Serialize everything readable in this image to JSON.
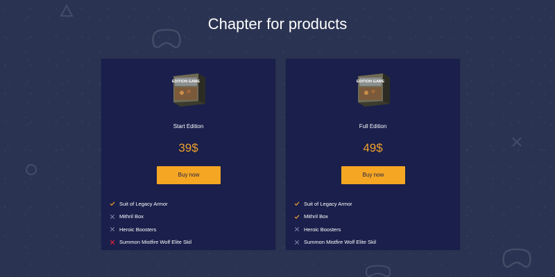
{
  "page": {
    "title": "Chapter for products"
  },
  "colors": {
    "background": "#2a3352",
    "card": "#1a1f4b",
    "accent": "#f5a623",
    "price": "#f0a12b",
    "check": "#f0a12b",
    "cross_muted": "#8a8fb0",
    "cross_red": "#e0223a"
  },
  "products": [
    {
      "name": "Start Edition",
      "price": "39$",
      "button_label": "Buy now",
      "box_text": "EDITION GAME",
      "features": [
        {
          "label": "Suit of Legacy Armor",
          "status": "included",
          "icon": "check-icon"
        },
        {
          "label": "Mithril Box",
          "status": "excluded",
          "icon": "cross-icon"
        },
        {
          "label": "Heroic Boosters",
          "status": "excluded",
          "icon": "cross-icon"
        },
        {
          "label": "Summon Mistfire Wolf Elite Skil",
          "status": "excluded-red",
          "icon": "cross-icon"
        }
      ]
    },
    {
      "name": "Full Edition",
      "price": "49$",
      "button_label": "Buy now",
      "box_text": "EDITION GAME",
      "features": [
        {
          "label": "Suit of Legacy Armor",
          "status": "included",
          "icon": "check-icon"
        },
        {
          "label": "Mithril Box",
          "status": "included",
          "icon": "check-icon"
        },
        {
          "label": "Heroic Boosters",
          "status": "excluded",
          "icon": "cross-icon"
        },
        {
          "label": "Summon Mistfire Wolf Elite Skil",
          "status": "excluded",
          "icon": "cross-icon"
        }
      ]
    }
  ]
}
